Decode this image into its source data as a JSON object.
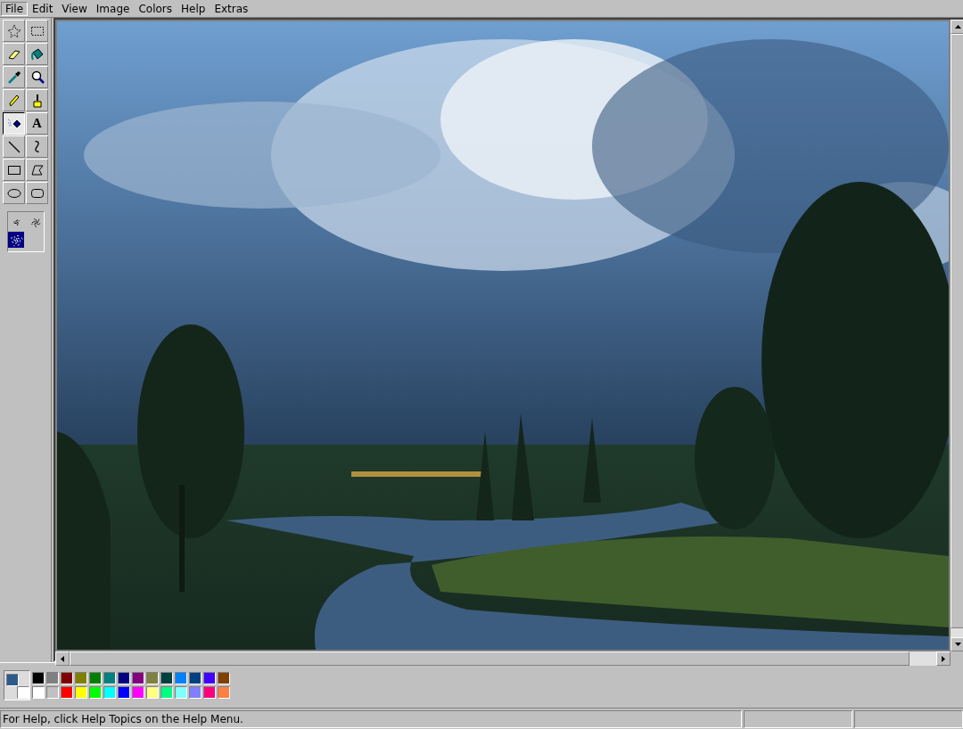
{
  "menu": [
    {
      "label": "File",
      "selected": true
    },
    {
      "label": "Edit",
      "selected": false
    },
    {
      "label": "View",
      "selected": false
    },
    {
      "label": "Image",
      "selected": false
    },
    {
      "label": "Colors",
      "selected": false
    },
    {
      "label": "Help",
      "selected": false
    },
    {
      "label": "Extras",
      "selected": false
    }
  ],
  "tools": [
    {
      "kind": "free-select",
      "selected": false
    },
    {
      "kind": "rect-select",
      "selected": false
    },
    {
      "kind": "eraser",
      "selected": false
    },
    {
      "kind": "fill",
      "selected": false
    },
    {
      "kind": "picker",
      "selected": false
    },
    {
      "kind": "magnifier",
      "selected": false
    },
    {
      "kind": "pencil",
      "selected": false
    },
    {
      "kind": "brush",
      "selected": false
    },
    {
      "kind": "airbrush",
      "selected": true
    },
    {
      "kind": "text",
      "glyph": "A",
      "selected": false
    },
    {
      "kind": "line",
      "selected": false
    },
    {
      "kind": "curve",
      "selected": false
    },
    {
      "kind": "rectangle",
      "selected": false
    },
    {
      "kind": "polygon",
      "selected": false
    },
    {
      "kind": "ellipse",
      "selected": false
    },
    {
      "kind": "rounded-rect",
      "selected": false
    }
  ],
  "spray_sizes": [
    {
      "selected": false
    },
    {
      "selected": false
    },
    {
      "selected": true
    }
  ],
  "current_colors": [
    {
      "kind": "foreground",
      "color": "#2f5a8c"
    },
    {
      "kind": "background",
      "color": "#ffffff"
    }
  ],
  "palette": [
    {
      "color": "#000000"
    },
    {
      "color": "#808080"
    },
    {
      "color": "#800000"
    },
    {
      "color": "#808000"
    },
    {
      "color": "#008000"
    },
    {
      "color": "#008080"
    },
    {
      "color": "#000080"
    },
    {
      "color": "#800080"
    },
    {
      "color": "#808040"
    },
    {
      "color": "#004040"
    },
    {
      "color": "#0080ff"
    },
    {
      "color": "#004080"
    },
    {
      "color": "#4000ff"
    },
    {
      "color": "#804000"
    },
    {
      "color": "#ffffff"
    },
    {
      "color": "#c0c0c0"
    },
    {
      "color": "#ff0000"
    },
    {
      "color": "#ffff00"
    },
    {
      "color": "#00ff00"
    },
    {
      "color": "#00ffff"
    },
    {
      "color": "#0000ff"
    },
    {
      "color": "#ff00ff"
    },
    {
      "color": "#ffff80"
    },
    {
      "color": "#00ff80"
    },
    {
      "color": "#80ffff"
    },
    {
      "color": "#8080ff"
    },
    {
      "color": "#ff0080"
    },
    {
      "color": "#ff8040"
    }
  ],
  "status_bar": {
    "text": "For Help, click Help Topics on the Help Menu."
  }
}
